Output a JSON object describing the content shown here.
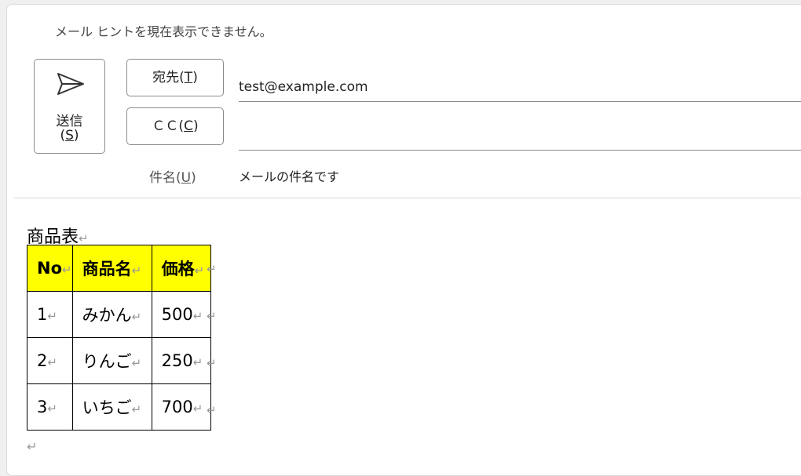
{
  "header": {
    "hint": "メール ヒントを現在表示できません。"
  },
  "send_button": {
    "line1": "送信",
    "line2_prefix": "(",
    "line2_key": "S",
    "line2_suffix": ")",
    "icon": "send-icon"
  },
  "to_button": {
    "prefix": "宛先(",
    "key": "T",
    "suffix": ")"
  },
  "cc_button": {
    "prefix": "ＣＣ(",
    "key": "C",
    "suffix": ")"
  },
  "to_field": {
    "value": "test@example.com"
  },
  "cc_field": {
    "value": ""
  },
  "subject": {
    "label_prefix": "件名(",
    "label_key": "U",
    "label_suffix": ")",
    "value": "メールの件名です"
  },
  "body": {
    "title": "商品表",
    "paragraph_mark": "↵",
    "table": {
      "headers": [
        "No",
        "商品名",
        "価格"
      ],
      "rows": [
        [
          "1",
          "みかん",
          "500"
        ],
        [
          "2",
          "りんご",
          "250"
        ],
        [
          "3",
          "いちご",
          "700"
        ]
      ]
    }
  },
  "colors": {
    "header_fill": "#ffff00",
    "border": "#8a8a8a"
  }
}
